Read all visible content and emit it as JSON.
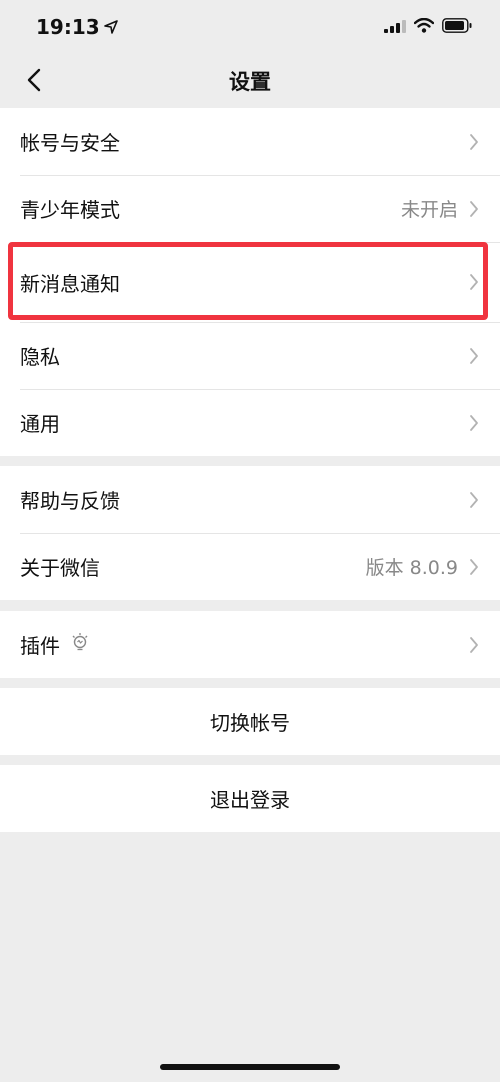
{
  "status_bar": {
    "time": "19:13",
    "icons": [
      "location-arrow-icon",
      "signal-icon",
      "wifi-icon",
      "battery-icon"
    ]
  },
  "nav": {
    "title": "设置",
    "back_icon": "chevron-left-icon"
  },
  "groups": [
    {
      "items": [
        {
          "label": "帐号与安全",
          "value": ""
        },
        {
          "label": "青少年模式",
          "value": "未开启"
        },
        {
          "label": "新消息通知",
          "value": ""
        },
        {
          "label": "隐私",
          "value": ""
        },
        {
          "label": "通用",
          "value": ""
        }
      ]
    },
    {
      "items": [
        {
          "label": "帮助与反馈",
          "value": ""
        },
        {
          "label": "关于微信",
          "value": "版本 8.0.9"
        }
      ]
    },
    {
      "items": [
        {
          "label": "插件",
          "value": "",
          "icon": "lightbulb-icon"
        }
      ]
    }
  ],
  "actions": {
    "switch_account": "切换帐号",
    "logout": "退出登录"
  },
  "colors": {
    "background": "#ededed",
    "highlight_border": "#f0343f",
    "secondary_text": "#888888"
  }
}
